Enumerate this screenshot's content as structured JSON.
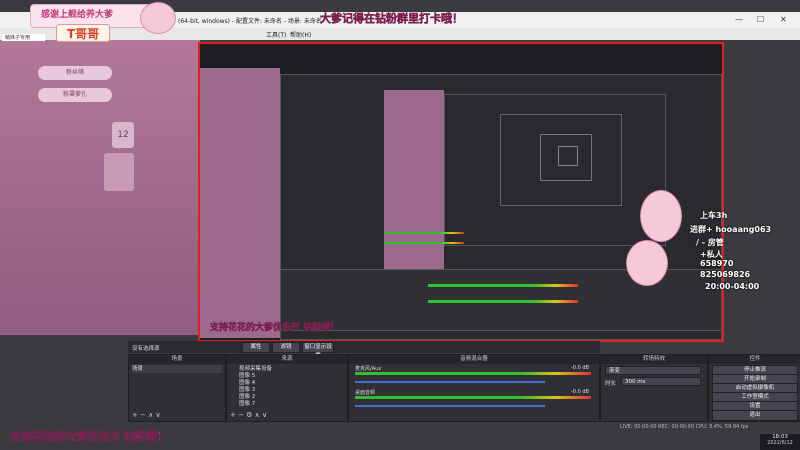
{
  "titlebar": {
    "text": "(64-bit, windows) - 配置文件: 未命名 - 场景: 未命名",
    "minimize": "—",
    "maximize": "☐",
    "close": "✕"
  },
  "menubar": {
    "items": [
      "工具(T)",
      "帮助(H)"
    ]
  },
  "left_panel": {
    "tab_label": "萌妹子专用",
    "items": [
      "粉丝萌",
      "粉罩萝扎"
    ],
    "card_number": "12"
  },
  "overlay": {
    "top_left_banner": "感谢上舰给养大爹",
    "logo_text": "T哥哥",
    "top_banner": "大爹记得在钻粉群里打卡哦！",
    "bottom_banner": "支持花花的大爹优先开 钻粉哦！",
    "inner_bottom_banner": "支持花花的大爹优先开 钻粉哦！",
    "schedule": [
      "上车3h",
      "进群+ hooaang063",
      "/ - 房管",
      "+私人",
      "658970",
      "825069826",
      "20:00-04:00"
    ]
  },
  "source_bar": {
    "label": "没有选择源",
    "properties": "属性",
    "filters": "滤镜",
    "scene_transition": "窗口显示设置"
  },
  "scenes": {
    "header": "场景",
    "items": [
      "场景"
    ]
  },
  "sources": {
    "header": "来源",
    "items": [
      "视频采集设备",
      "图像 5",
      "图像 4",
      "图像 3",
      "图像 2",
      "图像 7"
    ]
  },
  "mixer": {
    "header": "音频混合器",
    "channels": [
      {
        "name": "麦克风/Aux",
        "db": "-0.0 dB"
      },
      {
        "name": "桌面音频",
        "db": "-0.0 dB"
      }
    ]
  },
  "transitions": {
    "header": "转场特效",
    "type": "渐变",
    "duration_label": "时长",
    "duration": "300 ms"
  },
  "controls": {
    "header": "控件",
    "buttons": [
      "停止推流",
      "开始录制",
      "启动虚拟摄像机",
      "工作室模式",
      "设置",
      "退出"
    ]
  },
  "statusbar": {
    "text": "LIVE: 00:00:00  REC: 00:00:00  CPU: 3.4%, 59.94 fps"
  },
  "taskbar": {
    "time": "18:03",
    "date": "2022/6/12"
  }
}
